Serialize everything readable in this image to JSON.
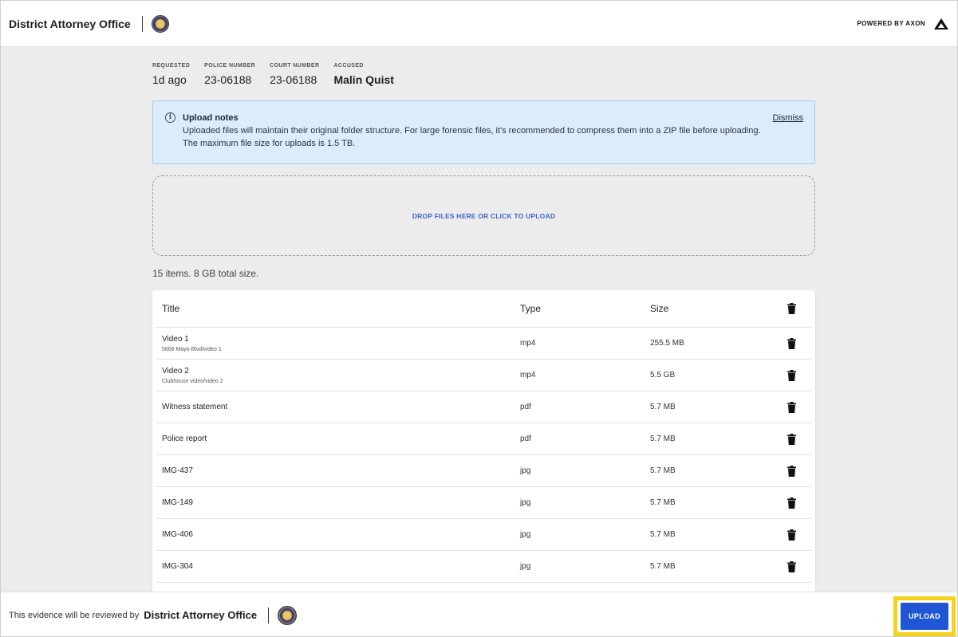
{
  "header": {
    "org_name": "District Attorney Office",
    "powered_by": "POWERED BY AXON"
  },
  "meta": {
    "requested_label": "REQUESTED",
    "requested_value": "1d ago",
    "police_label": "POLICE NUMBER",
    "police_value": "23-06188",
    "court_label": "COURT NUMBER",
    "court_value": "23-06188",
    "accused_label": "ACCUSED",
    "accused_value": "Malin Quist"
  },
  "notes": {
    "title": "Upload notes",
    "dismiss": "Dismiss",
    "line1": "Uploaded files will maintain their original folder structure. For large forensic files, it's recommended to compress them into a ZIP file before uploading.",
    "line2": "The maximum file size for uploads is 1.5 TB."
  },
  "dropzone": {
    "label": "DROP FILES HERE OR CLICK TO UPLOAD"
  },
  "summary": "15 items. 8 GB total size.",
  "table": {
    "headers": {
      "title": "Title",
      "type": "Type",
      "size": "Size"
    },
    "rows": [
      {
        "title": "Video 1",
        "path": "5666 Mayo Blvd/video 1",
        "type": "mp4",
        "size": "255.5 MB"
      },
      {
        "title": "Video 2",
        "path": "Clubhouse video/video 2",
        "type": "mp4",
        "size": "5.5 GB"
      },
      {
        "title": "Witness statement",
        "path": "",
        "type": "pdf",
        "size": "5.7 MB"
      },
      {
        "title": "Police report",
        "path": "",
        "type": "pdf",
        "size": "5.7 MB"
      },
      {
        "title": "IMG-437",
        "path": "",
        "type": "jpg",
        "size": "5.7 MB"
      },
      {
        "title": "IMG-149",
        "path": "",
        "type": "jpg",
        "size": "5.7 MB"
      },
      {
        "title": "IMG-406",
        "path": "",
        "type": "jpg",
        "size": "5.7 MB"
      },
      {
        "title": "IMG-304",
        "path": "",
        "type": "jpg",
        "size": "5.7 MB"
      }
    ]
  },
  "footer": {
    "review_text": "This evidence will be reviewed by",
    "org_name": "District Attorney Office",
    "upload_label": "UPLOAD"
  },
  "icons": {
    "info": "info-icon",
    "trash": "trash-icon",
    "axon_logo": "axon-logo-icon",
    "seal": "seal-icon"
  },
  "colors": {
    "accent": "#1f56d6",
    "highlight": "#f5d21b",
    "notes_bg": "#dcecfb",
    "link": "#3d67c9"
  }
}
